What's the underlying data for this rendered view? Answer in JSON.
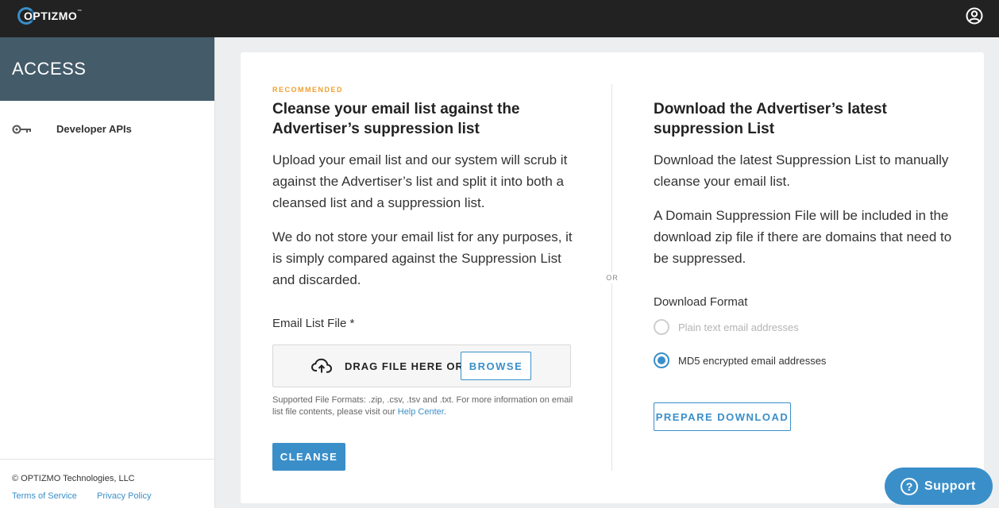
{
  "brand": {
    "logo_text": "OPTIZMO",
    "logo_tm": "™"
  },
  "sidebar": {
    "title": "ACCESS",
    "items": [
      {
        "label": "Developer APIs",
        "icon": "key-icon"
      }
    ],
    "footer": {
      "copyright": "© OPTIZMO Technologies, LLC",
      "links": [
        "Terms of Service",
        "Privacy Policy"
      ]
    }
  },
  "left": {
    "eyebrow": "RECOMMENDED",
    "heading": "Cleanse your email list against the Advertiser’s suppression list",
    "para1": "Upload your email list and our system will scrub it against the Advertiser’s list and split it into both a cleansed list and a suppression list.",
    "para2": "We do not store your email list for any purposes, it is simply compared against the Suppression List and discarded.",
    "field_label": "Email List File *",
    "drag_text": "DRAG FILE HERE OR",
    "browse_label": "BROWSE",
    "help_text": "Supported File Formats: .zip, .csv, .tsv and .txt. For more information on email list file contents, please visit our",
    "help_link": "Help Center",
    "help_end": ".",
    "cleanse_label": "CLEANSE"
  },
  "divider_label": "OR",
  "right": {
    "heading": "Download the Advertiser’s latest suppression List",
    "para1": "Download the latest Suppression List to manually cleanse your email list.",
    "para2": "A Domain Suppression File will be included in the download zip file if there are domains that need to be suppressed.",
    "format_label": "Download Format",
    "options": [
      {
        "label": "Plain text email addresses",
        "selected": false,
        "disabled": true
      },
      {
        "label": "MD5 encrypted email addresses",
        "selected": true,
        "disabled": false
      }
    ],
    "prepare_label": "PREPARE DOWNLOAD"
  },
  "support": {
    "label": "Support",
    "icon": "question-icon"
  },
  "colors": {
    "accent": "#3a8fc9",
    "sidebar_header": "#445b6a",
    "topbar": "#222222",
    "eyebrow": "#f0a030"
  }
}
